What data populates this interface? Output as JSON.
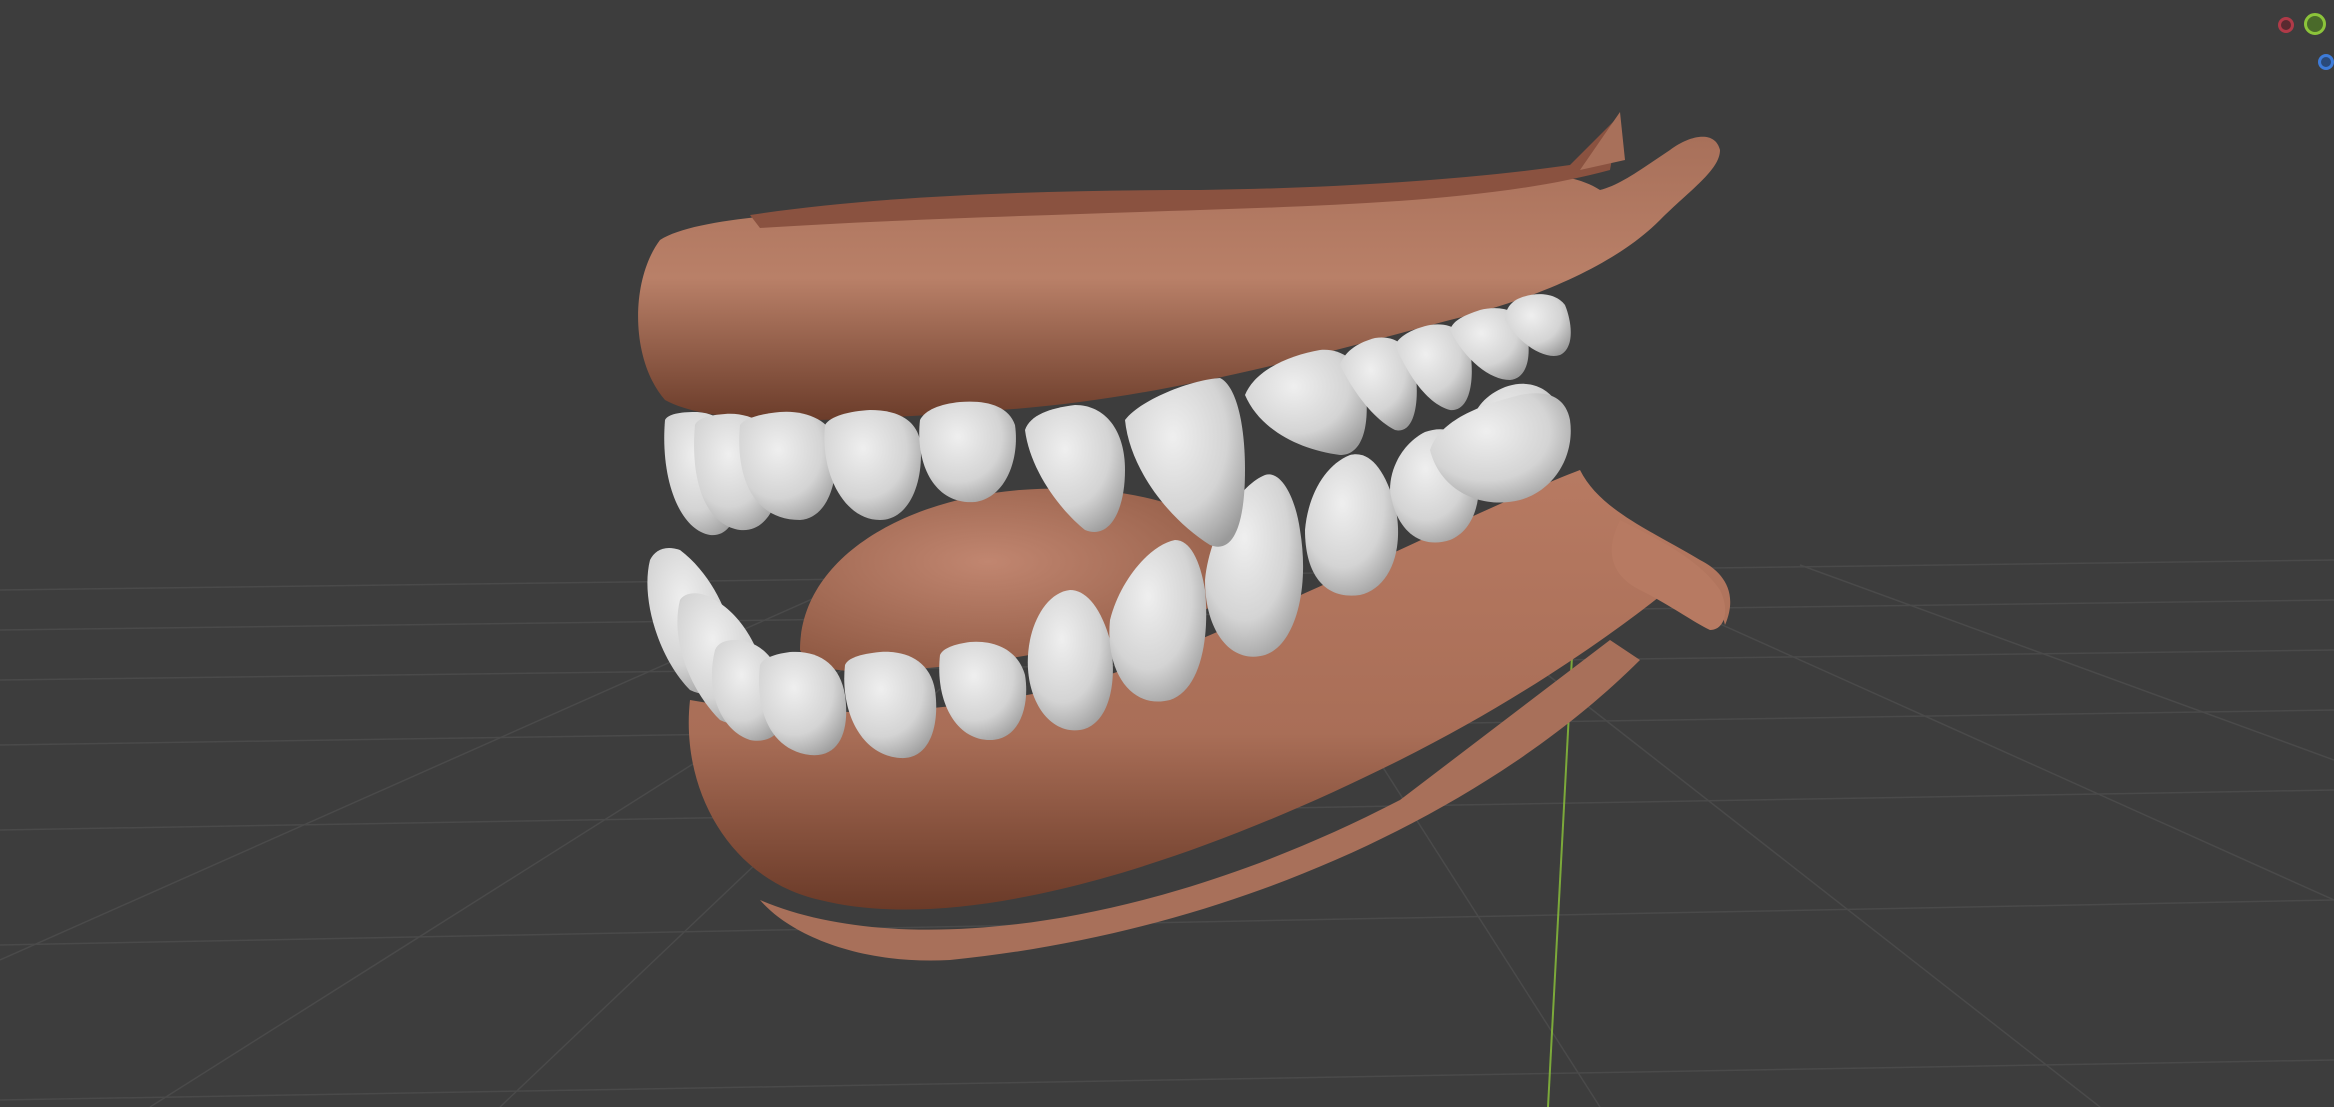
{
  "app": {
    "view": "3D Viewport",
    "background_color": "#3d3d3d"
  },
  "scene": {
    "object": "teeth-and-gums-model",
    "gum_color": "#b77a62",
    "teeth_color": "#d9d9d9",
    "grid_line_color": "#4a4a4a",
    "y_axis_color": "#8cc43a"
  },
  "navigation_gizmo": {
    "x_axis_color": "#b03a48",
    "y_axis_color": "#8cc43a",
    "z_axis_color": "#3d7bd8",
    "icons": [
      "x-axis-icon",
      "y-axis-icon",
      "z-axis-icon"
    ]
  }
}
